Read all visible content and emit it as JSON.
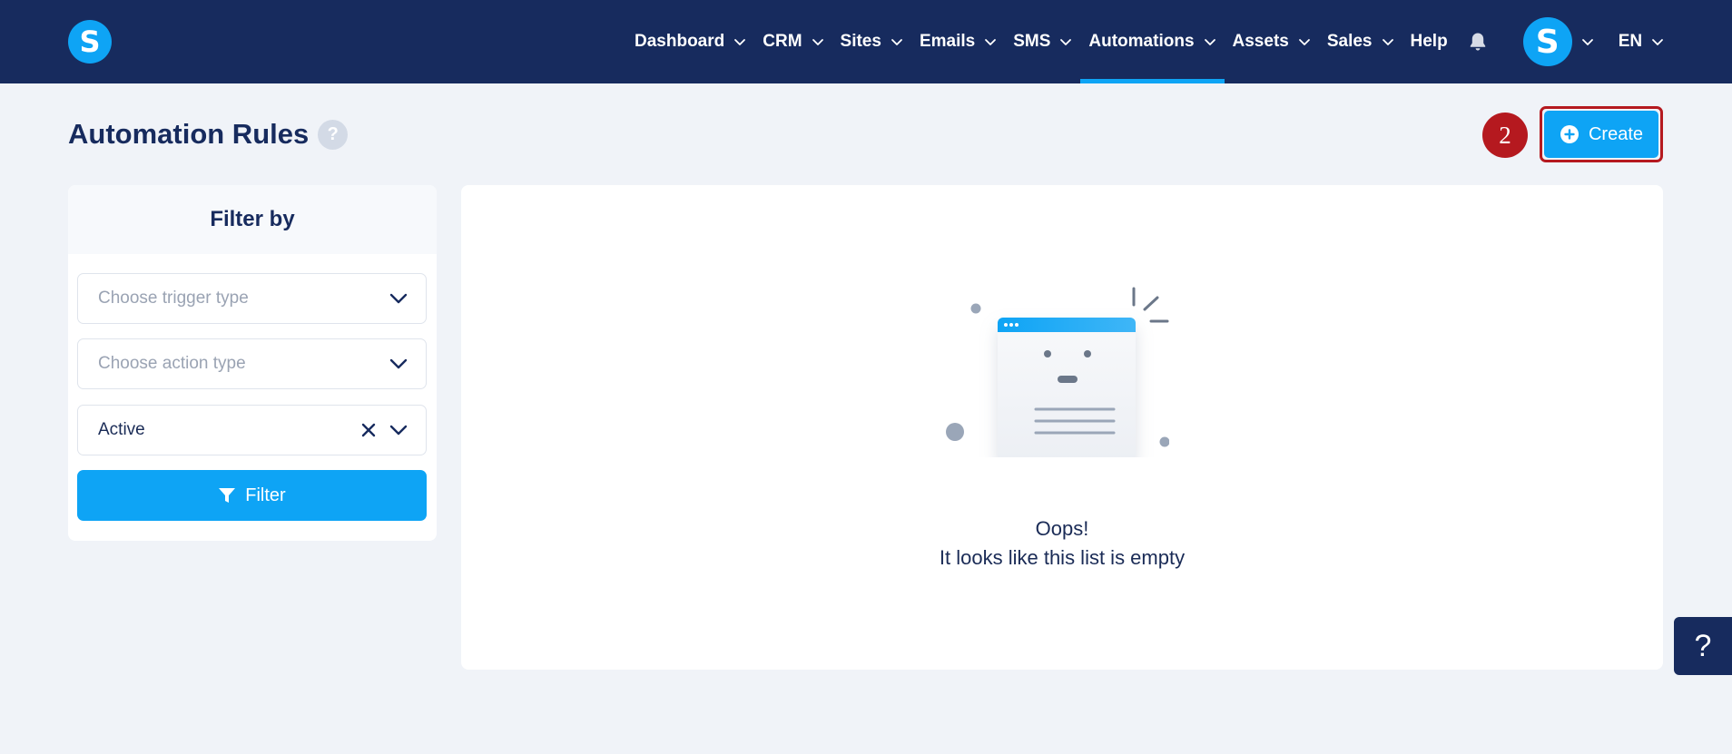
{
  "brand": {
    "logo_letter": "S",
    "accent": "#0ea4f5",
    "nav_bg": "#172b5e"
  },
  "nav": {
    "items": [
      {
        "label": "Dashboard",
        "dropdown": true
      },
      {
        "label": "CRM",
        "dropdown": true
      },
      {
        "label": "Sites",
        "dropdown": true
      },
      {
        "label": "Emails",
        "dropdown": true
      },
      {
        "label": "SMS",
        "dropdown": true
      },
      {
        "label": "Automations",
        "dropdown": true,
        "active": true
      },
      {
        "label": "Assets",
        "dropdown": true
      },
      {
        "label": "Sales",
        "dropdown": true
      },
      {
        "label": "Help",
        "dropdown": false
      }
    ],
    "notification_icon": "bell-icon",
    "avatar_letter": "S",
    "language": "EN"
  },
  "page": {
    "title": "Automation Rules",
    "help_glyph": "?",
    "step_badge": "2",
    "create_label": "Create",
    "create_icon": "plus-circle-icon",
    "step_badge_color": "#b5191f"
  },
  "filter": {
    "heading": "Filter by",
    "trigger_placeholder": "Choose trigger type",
    "action_placeholder": "Choose action type",
    "status_value": "Active",
    "filter_button_label": "Filter",
    "filter_icon": "funnel-icon"
  },
  "empty_state": {
    "title": "Oops!",
    "message": "It looks like this list is empty"
  },
  "floating_help": {
    "glyph": "?"
  }
}
